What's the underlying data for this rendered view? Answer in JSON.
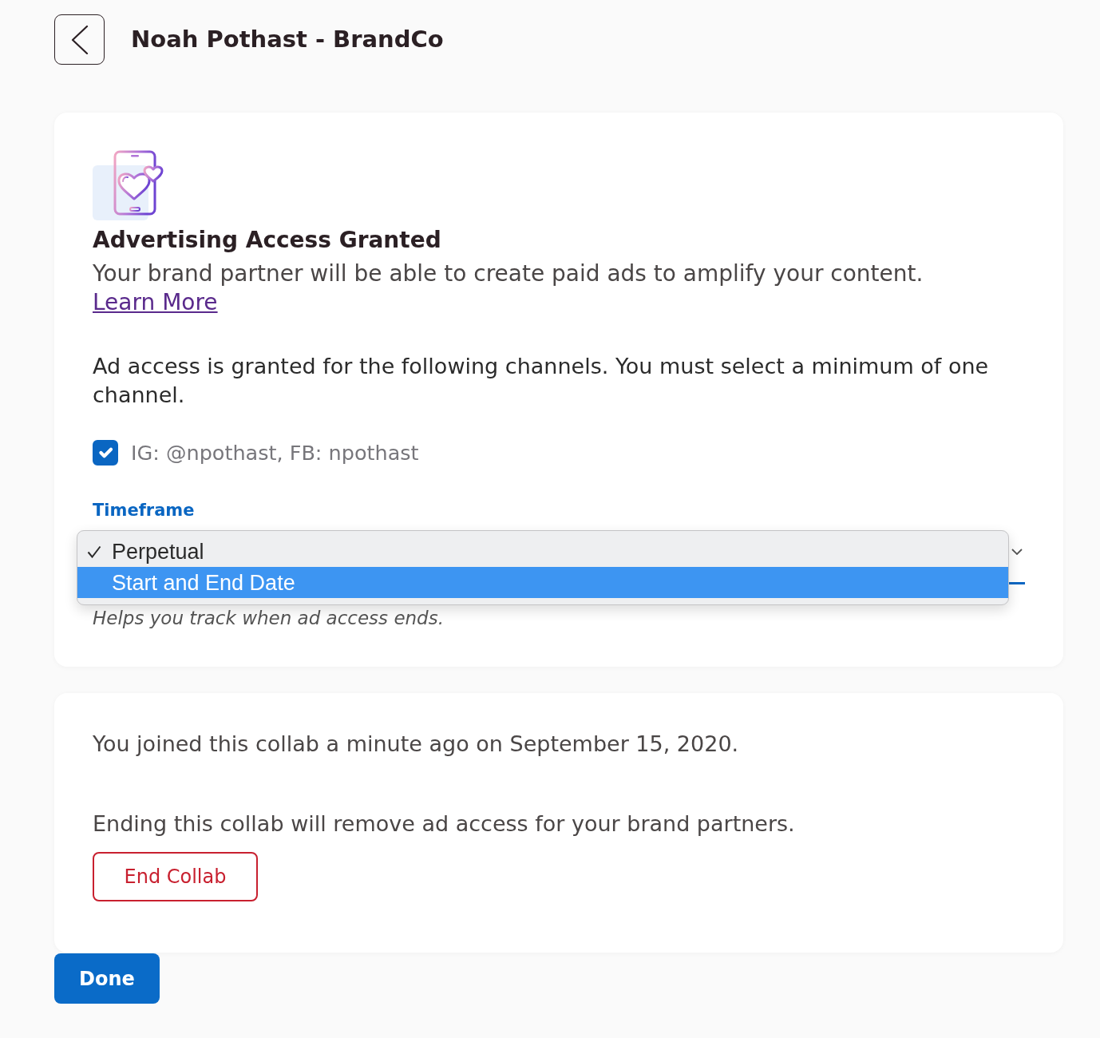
{
  "header": {
    "title": "Noah Pothast - BrandCo"
  },
  "access_card": {
    "title": "Advertising Access Granted",
    "description": "Your brand partner will be able to create paid ads to amplify your content.",
    "link": "Learn More",
    "channels_note": "Ad access is granted for the following channels. You must select a minimum of one channel.",
    "channels": [
      {
        "label": "IG: @npothast, FB: npothast",
        "checked": true
      }
    ],
    "timeframe": {
      "label": "Timeframe",
      "expanded": true,
      "options": [
        {
          "label": "Perpetual",
          "selected": true,
          "highlighted": false
        },
        {
          "label": "Start and End Date",
          "selected": false,
          "highlighted": true
        }
      ],
      "hint": "Helps you track when ad access ends."
    }
  },
  "collab_card": {
    "joined_text": "You joined this collab a minute ago on September 15, 2020.",
    "ending_text": "Ending this collab will remove ad access for your brand partners.",
    "end_button": "End Collab"
  },
  "done_button": "Done"
}
